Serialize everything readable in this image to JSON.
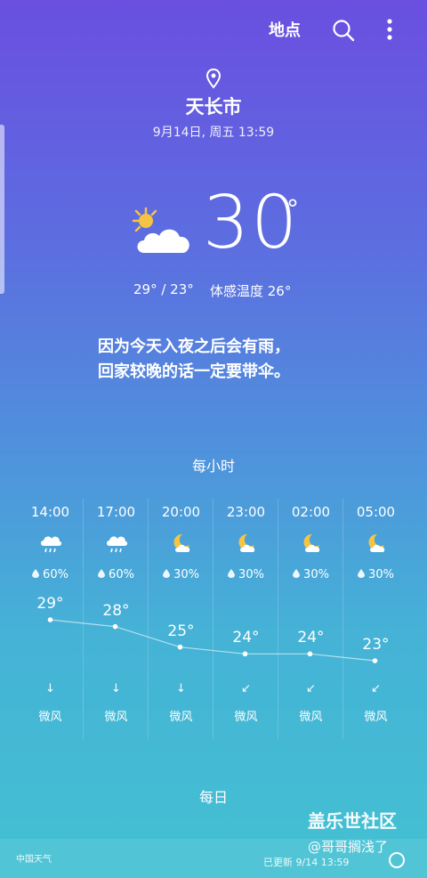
{
  "header": {
    "location_label": "地点"
  },
  "location": {
    "city": "天长市",
    "datetime": "9月14日, 周五 13:59"
  },
  "current": {
    "temp": "30",
    "deg": "°",
    "range": "29° / 23°",
    "feels": "体感温度 26°",
    "icon": "partly-sunny"
  },
  "message": {
    "line1": "因为今天入夜之后会有雨，",
    "line2": "回家较晚的话一定要带伞。"
  },
  "hourly": {
    "title": "每小时",
    "items": [
      {
        "time": "14:00",
        "icon": "rain-cloud",
        "rain": "60%",
        "temp": "29°",
        "temp_value": 29,
        "wind_dir": "↓",
        "wind": "微风"
      },
      {
        "time": "17:00",
        "icon": "rain-cloud",
        "rain": "60%",
        "temp": "28°",
        "temp_value": 28,
        "wind_dir": "↓",
        "wind": "微风"
      },
      {
        "time": "20:00",
        "icon": "moon-cloud",
        "rain": "30%",
        "temp": "25°",
        "temp_value": 25,
        "wind_dir": "↓",
        "wind": "微风"
      },
      {
        "time": "23:00",
        "icon": "moon-cloud",
        "rain": "30%",
        "temp": "24°",
        "temp_value": 24,
        "wind_dir": "↙",
        "wind": "微风"
      },
      {
        "time": "02:00",
        "icon": "moon-cloud",
        "rain": "30%",
        "temp": "24°",
        "temp_value": 24,
        "wind_dir": "↙",
        "wind": "微风"
      },
      {
        "time": "05:00",
        "icon": "moon-cloud",
        "rain": "30%",
        "temp": "23°",
        "temp_value": 23,
        "wind_dir": "↙",
        "wind": "微风"
      }
    ]
  },
  "daily": {
    "title": "每日"
  },
  "footer": {
    "brand": "中国天气",
    "updated": "已更新 9/14 13:59"
  },
  "watermark": {
    "line1": "盖乐世社区",
    "line2": "@哥哥搁浅了"
  },
  "colors": {
    "gradient_top": "#6a4fe0",
    "gradient_bottom": "#43c1d2",
    "sun": "#f6c444"
  }
}
